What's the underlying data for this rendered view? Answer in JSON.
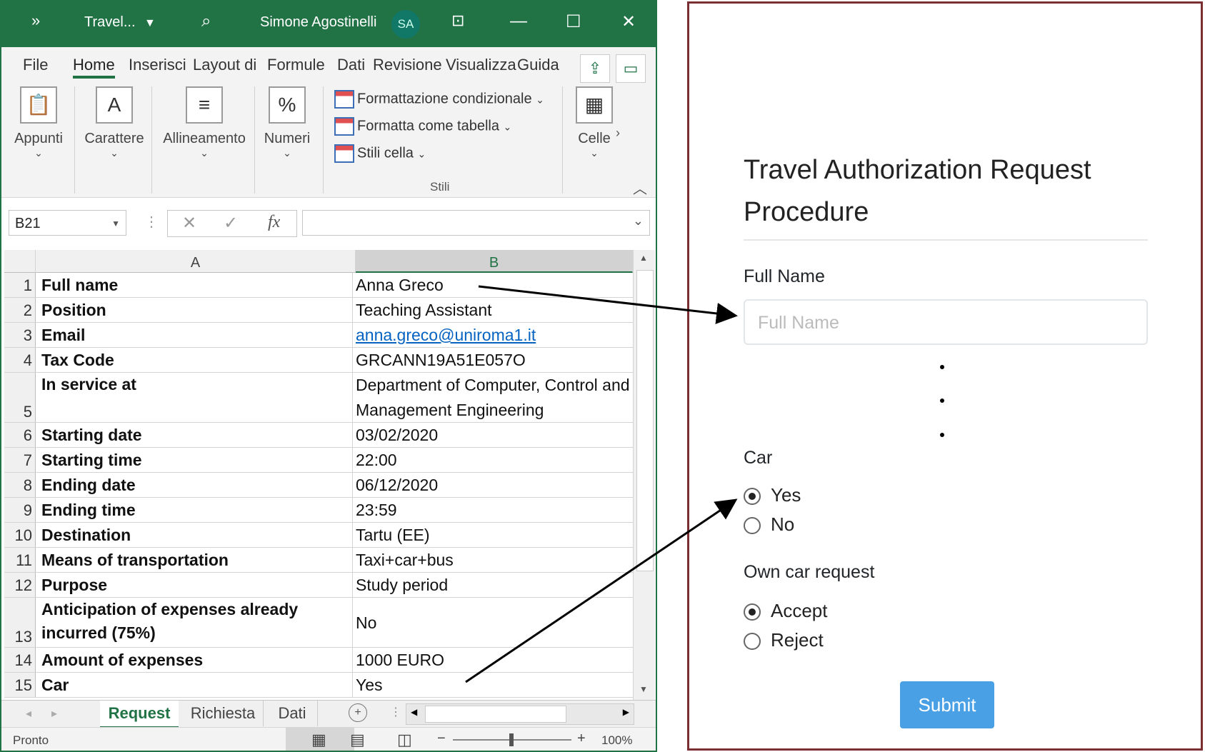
{
  "excel": {
    "title": "Travel...",
    "user": "Simone Agostinelli",
    "initials": "SA",
    "tabs": [
      "File",
      "Home",
      "Inserisci",
      "Layout di",
      "Formule",
      "Dati",
      "Revisione",
      "Visualizza",
      "Guida"
    ],
    "ribbon": {
      "appunti": "Appunti",
      "carattere": "Carattere",
      "allineamento": "Allineamento",
      "numeri": "Numeri",
      "formattazione": "Formattazione condizionale",
      "formatta_tabella": "Formatta come tabella",
      "stili_cella": "Stili cella",
      "stili": "Stili",
      "celle": "Celle"
    },
    "name_box": "B21",
    "columns": [
      "A",
      "B"
    ],
    "rows": [
      {
        "n": "1",
        "a": "Full name",
        "b": "Anna Greco"
      },
      {
        "n": "2",
        "a": "Position",
        "b": "Teaching Assistant"
      },
      {
        "n": "3",
        "a": "Email",
        "b": "anna.greco@uniroma1.it"
      },
      {
        "n": "4",
        "a": "Tax Code",
        "b": "GRCANN19A51E057O"
      },
      {
        "n": "5",
        "a": "In service at",
        "b": "Department of Computer, Control and Management Engineering"
      },
      {
        "n": "6",
        "a": "Starting date",
        "b": "03/02/2020"
      },
      {
        "n": "7",
        "a": "Starting time",
        "b": "22:00"
      },
      {
        "n": "8",
        "a": "Ending date",
        "b": "06/12/2020"
      },
      {
        "n": "9",
        "a": "Ending time",
        "b": "23:59"
      },
      {
        "n": "10",
        "a": "Destination",
        "b": "Tartu (EE)"
      },
      {
        "n": "11",
        "a": "Means of transportation",
        "b": "Taxi+car+bus"
      },
      {
        "n": "12",
        "a": "Purpose",
        "b": "Study period"
      },
      {
        "n": "13",
        "a": "Anticipation of expenses already incurred (75%)",
        "b": "No"
      },
      {
        "n": "14",
        "a": "Amount of expenses",
        "b": "1000 EURO"
      },
      {
        "n": "15",
        "a": "Car",
        "b": "Yes"
      }
    ],
    "sheet_tabs": [
      "Request",
      "Richiesta",
      "Dati"
    ],
    "status": "Pronto",
    "zoom": "100%"
  },
  "form": {
    "title": "Travel Authorization Request Procedure",
    "full_name_label": "Full Name",
    "full_name_placeholder": "Full Name",
    "car_label": "Car",
    "car_yes": "Yes",
    "car_no": "No",
    "own_car_label": "Own car request",
    "accept": "Accept",
    "reject": "Reject",
    "submit": "Submit"
  }
}
